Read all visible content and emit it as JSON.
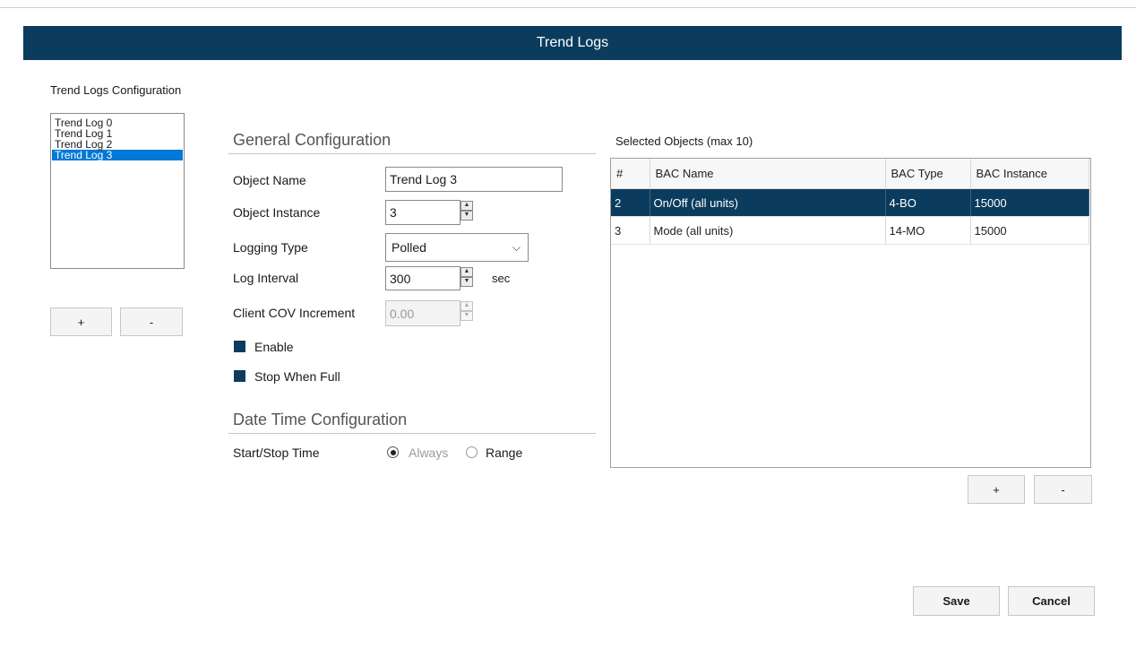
{
  "window": {
    "title": "Trend Logs"
  },
  "left_panel": {
    "heading": "Trend Logs Configuration",
    "logs": [
      "Trend Log 0",
      "Trend Log 1",
      "Trend Log 2",
      "Trend Log 3"
    ],
    "selected_index": 3,
    "add_label": "+",
    "remove_label": "-"
  },
  "general": {
    "heading": "General Configuration",
    "object_name_label": "Object Name",
    "object_name_value": "Trend Log 3",
    "object_instance_label": "Object Instance",
    "object_instance_value": "3",
    "logging_type_label": "Logging Type",
    "logging_type_value": "Polled",
    "log_interval_label": "Log Interval",
    "log_interval_value": "300",
    "log_interval_unit": "sec",
    "client_cov_label": "Client COV Increment",
    "client_cov_value": "0.00",
    "enable_label": "Enable",
    "enable_checked": true,
    "stop_when_full_label": "Stop When Full",
    "stop_when_full_checked": true
  },
  "datetime": {
    "heading": "Date Time Configuration",
    "start_stop_label": "Start/Stop Time",
    "always_label": "Always",
    "range_label": "Range",
    "selected": "Always"
  },
  "objects": {
    "heading": "Selected Objects (max 10)",
    "columns": [
      "#",
      "BAC Name",
      "BAC Type",
      "BAC Instance"
    ],
    "rows": [
      {
        "num": "2",
        "name": "On/Off (all units)",
        "type": "4-BO",
        "instance": "15000"
      },
      {
        "num": "3",
        "name": "Mode (all units)",
        "type": "14-MO",
        "instance": "15000"
      }
    ],
    "selected_row": 0,
    "add_label": "+",
    "remove_label": "-"
  },
  "footer": {
    "save_label": "Save",
    "cancel_label": "Cancel"
  },
  "colors": {
    "accent": "#0b3c5d",
    "list_selection": "#0078d7"
  }
}
